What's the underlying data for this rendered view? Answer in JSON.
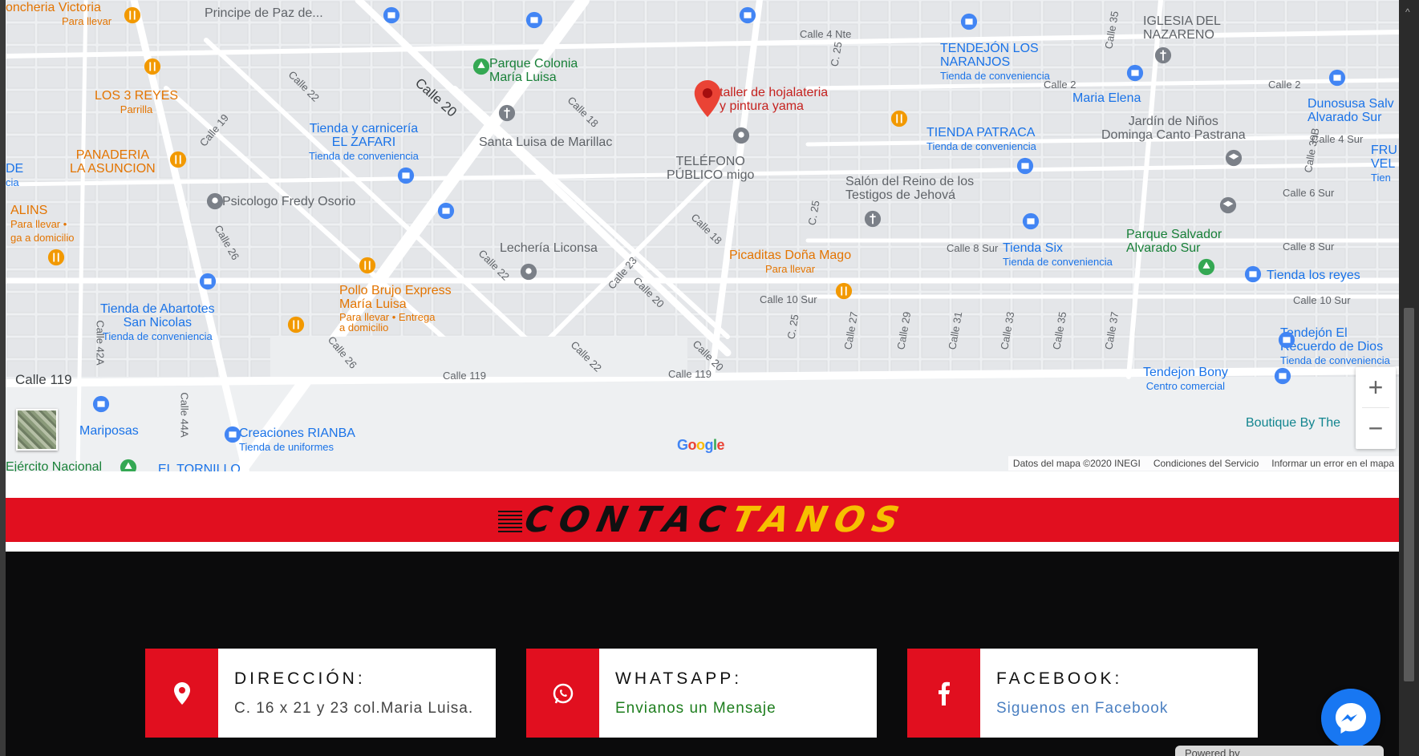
{
  "map": {
    "pois": [
      {
        "name": "Principe de Paz de...",
        "cls": "poi-gray"
      },
      {
        "name": "Parque Colonia",
        "sub": "María Luisa",
        "cls": "poi-green"
      },
      {
        "name": "taller de hojalateria",
        "sub": "y pintura yama",
        "cls": "poi-red"
      },
      {
        "name": "IGLESIA DEL",
        "sub": "NAZARENO",
        "cls": "poi-gray"
      },
      {
        "name": "TENDEJÓN LOS",
        "sub": "NARANJOS",
        "sub2": "Tienda de conveniencia",
        "cls": "poi-blue"
      },
      {
        "name": "LOS 3 REYES",
        "sub": "Parrilla",
        "cls": "poi-orange"
      },
      {
        "name": "Tienda y carnicería",
        "sub": "EL ZAFARI",
        "sub2": "Tienda de conveniencia",
        "cls": "poi-blue"
      },
      {
        "name": "Santa Luisa de Marillac",
        "cls": "poi-gray"
      },
      {
        "name": "TELÉFONO",
        "sub": "PÚBLICO migo",
        "cls": "poi-gray"
      },
      {
        "name": "Maria Elena",
        "cls": "poi-blue"
      },
      {
        "name": "Jardín de Niños",
        "sub": "Dominga Canto Pastrana",
        "cls": "poi-gray"
      },
      {
        "name": "Dunosusa Salv",
        "sub": "Alvarado Sur",
        "cls": "poi-blue"
      },
      {
        "name": "PANADERIA",
        "sub": "LA ASUNCION",
        "cls": "poi-orange"
      },
      {
        "name": "TIENDA PATRACA",
        "sub": "Tienda de conveniencia",
        "cls": "poi-blue"
      },
      {
        "name": "Salón del Reino de los",
        "sub": "Testigos de Jehová",
        "cls": "poi-gray"
      },
      {
        "name": "ALINS",
        "sub": "Para llevar •",
        "sub2": "ga a domicilio",
        "cls": "poi-orange"
      },
      {
        "name": "Psicologo Fredy Osorio",
        "cls": "poi-gray"
      },
      {
        "name": "Lechería Liconsa",
        "cls": "poi-gray"
      },
      {
        "name": "Picaditas Doña Mago",
        "sub": "Para llevar",
        "cls": "poi-orange"
      },
      {
        "name": "Tienda Six",
        "sub": "Tienda de conveniencia",
        "cls": "poi-blue"
      },
      {
        "name": "Parque Salvador",
        "sub": "Alvarado Sur",
        "cls": "poi-green"
      },
      {
        "name": "Tienda los reyes",
        "cls": "poi-blue"
      },
      {
        "name": "Pollo Brujo Express",
        "sub": "María Luisa",
        "sub2": "Para llevar • Entrega a domicilio",
        "cls": "poi-orange"
      },
      {
        "name": "Tienda de Abartotes",
        "sub": "San Nicolas",
        "sub2": "Tienda de conveniencia",
        "cls": "poi-blue"
      },
      {
        "name": "Tendejón El",
        "sub": "Recuerdo de Dios",
        "sub2": "Tienda de conveniencia",
        "cls": "poi-blue"
      },
      {
        "name": "Tendejon Bony",
        "sub": "Centro comercial",
        "cls": "poi-blue"
      },
      {
        "name": "Mariposas",
        "cls": "poi-blue"
      },
      {
        "name": "Creaciones RIANBA",
        "sub": "Tienda de uniformes",
        "cls": "poi-blue"
      },
      {
        "name": "Boutique By The",
        "cls": "poi-teal"
      },
      {
        "name": "Ejército Nacional",
        "cls": "poi-green"
      },
      {
        "name": "EL TORNILLO",
        "cls": "poi-blue"
      },
      {
        "name": "oncheria Victoria",
        "sub": "Para llevar",
        "cls": "poi-orange"
      },
      {
        "name": "FRU",
        "sub": "VEL",
        "sub2": "Tien",
        "cls": "poi-blue"
      },
      {
        "name": "DE",
        "sub": "cia",
        "cls": "poi-blue"
      }
    ],
    "streets": [
      "Calle 20",
      "Calle 22",
      "Calle 19",
      "Calle 18",
      "Calle 18",
      "Calle 26",
      "Calle 22",
      "Calle 23",
      "Calle 20",
      "Calle 26",
      "Calle 22",
      "Calle 20",
      "Calle 42A",
      "Calle 119",
      "Calle 119",
      "Calle 119",
      "Calle 44A",
      "Calle 4 Nte",
      "C. 25",
      "Calle 35",
      "Calle 2",
      "Calle 2",
      "Calle 39B",
      "Calle 4 Sur",
      "Calle 6 Sur",
      "C. 25",
      "Calle 8 Sur",
      "Calle 8 Sur",
      "Calle 10 Sur",
      "Calle 10 Sur",
      "C. 25",
      "Calle 27",
      "Calle 29",
      "Calle 31",
      "Calle 33",
      "Calle 35",
      "Calle 37"
    ],
    "zoom_in": "+",
    "zoom_out": "−",
    "google_logo": "Google",
    "attribution": {
      "data": "Datos del mapa ©2020 INEGI",
      "terms": "Condiciones del Servicio",
      "report": "Informar un error en el mapa"
    }
  },
  "banner": {
    "part1": "CONTAC",
    "part2": "TANOS"
  },
  "contact": [
    {
      "heading": "DIRECCIÓN:",
      "value": "C. 16 x 21 y 23 col.Maria Luisa.",
      "value_color": "#444444",
      "icon": "map-pin-icon"
    },
    {
      "heading": "WHATSAPP:",
      "value": "Envianos un Mensaje",
      "value_color": "#1e7e1e",
      "icon": "whatsapp-icon"
    },
    {
      "heading": "FACEBOOK:",
      "value": "Siguenos en Facebook",
      "value_color": "#4a7fc1",
      "icon": "facebook-icon"
    }
  ],
  "colors": {
    "accent_red": "#e10f1f",
    "banner_yellow": "#f6c000",
    "dark_bg": "#0b0b0c",
    "messenger_blue": "#1877f2"
  },
  "powered": "Powered by"
}
